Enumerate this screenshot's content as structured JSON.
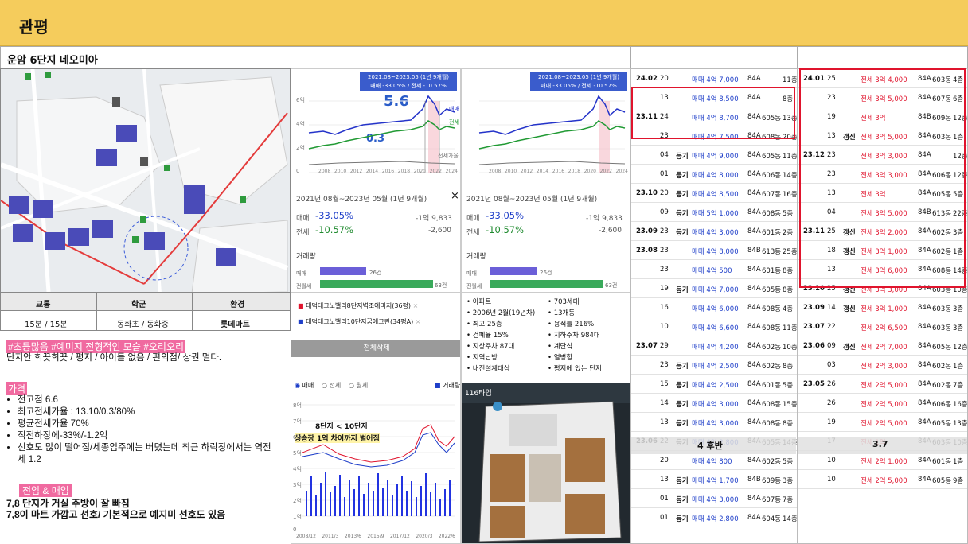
{
  "header": {
    "title": "관평"
  },
  "sheet": {
    "complex_name": "운암 6단지 네오미아"
  },
  "info_table": {
    "headers": [
      "교통",
      "학군",
      "환경"
    ],
    "values": [
      "15분 / 15분",
      "동화초 / 동화중",
      "롯데마트"
    ]
  },
  "notes": {
    "hashtags": "#초등많음 #예미지 전형적인 모습 #오리오리",
    "desc": "단지안 희끗희끗 / 평지 / 아이들 없음 / 편의점/ 상권 멀다.",
    "price_tag": "가격",
    "bullets": [
      "전고점 6.6",
      "최고전세가율 : 13.10/0.3/80%",
      "평균전세가율 70%",
      "직전하장에-33%/-1.2억",
      "선호도 많이 떨어짐/세종입주에는 버텼는데 최근 하락장에서는 역전세 1.2"
    ],
    "tag2": "전임 & 매임",
    "line1": "7,8 단지가 거실 주방이 잘 빠짐",
    "line2": "7,8이 마트 가깝고 선호/ 기본적으로 예지미 선호도 있음"
  },
  "chart_card_1": {
    "period": "2021.08~2023.05 (1년 9개월)",
    "summary": "매매 -33.05% / 전세 -10.57%",
    "peak_annot": "5.6",
    "low_annot": "0.3",
    "x_ticks": [
      "2008",
      "2010",
      "2012",
      "2014",
      "2016",
      "2018",
      "2020",
      "2022",
      "2024"
    ],
    "legend": [
      "매매",
      "전세"
    ],
    "y_ticks": [
      "6억",
      "4억",
      "2억",
      "0"
    ],
    "side": "전세가율"
  },
  "chart_card_2": {
    "period": "2021.08~2023.05 (1년 9개월)",
    "summary": "매매 -33.05% / 전세 -10.57%",
    "x_ticks": [
      "2008",
      "2010",
      "2012",
      "2014",
      "2016",
      "2018",
      "2020",
      "2022",
      "2024"
    ]
  },
  "stats": {
    "period": "2021년 08월~2023년 05월 (1년 9개월)",
    "rows": [
      {
        "label": "매매",
        "pct": "-33.05%",
        "amt": "-1억 9,833"
      },
      {
        "label": "전세",
        "pct": "-10.57%",
        "amt": "-2,600"
      }
    ],
    "volume_title": "거래량",
    "volume": [
      {
        "label": "매매",
        "value": "26건"
      },
      {
        "label": "전월세",
        "value": "63건"
      }
    ],
    "close": "×"
  },
  "stats2": {
    "period": "2021년 08월~2023년 05월 (1년 9개월)",
    "rows": [
      {
        "label": "매매",
        "pct": "-33.05%",
        "amt": "-1억 9,833"
      },
      {
        "label": "전세",
        "pct": "-10.57%",
        "amt": "-2,600"
      }
    ],
    "volume_title": "거래량",
    "volume": [
      {
        "label": "매매",
        "value": "26건"
      },
      {
        "label": "전월세",
        "value": "63건"
      }
    ]
  },
  "compare": {
    "items": [
      "대덕테크노밸리8단지벽조예미지(36평)",
      "대덕테크노밸리10단지꿈에그린(34평A)"
    ],
    "delete_btn": "전체삭제",
    "radios": [
      "매매",
      "전세",
      "월세"
    ],
    "vol_label": "거래량",
    "annot1": "8단지 < 10단지",
    "annot2": "상승장 1억 차이까지 벌어짐",
    "x_ticks": [
      "2008/12",
      "2011/3",
      "2013/6",
      "2015/9",
      "2017/12",
      "2020/3",
      "2022/6"
    ],
    "y_ticks": [
      "8억",
      "7억",
      "6억",
      "5억",
      "4억",
      "3억",
      "2억",
      "1억",
      "0"
    ]
  },
  "apt_info": {
    "col1": [
      "아파트",
      "2006년 2월(19년차)",
      "최고 25층",
      "건폐율 15%",
      "지상주차 87대",
      "지역난방",
      "내진설계대상"
    ],
    "col2": [
      "703세대",
      "13개동",
      "용적률 216%",
      "지하주차 984대",
      "계단식",
      "열병합",
      "평지에 있는 단지"
    ],
    "plan_label": "116타입"
  },
  "sale_list": {
    "rows": [
      [
        "24.02",
        "20",
        "",
        "매매 4억 7,000",
        "84A",
        "",
        "11층"
      ],
      [
        "",
        "13",
        "",
        "매매 4억 8,500",
        "84A",
        "",
        "8층"
      ],
      [
        "23.11",
        "24",
        "",
        "매매 4억 8,700",
        "84A",
        "605동",
        "13층"
      ],
      [
        "",
        "23",
        "",
        "매매 4억 7,500",
        "84A",
        "608동",
        "20층"
      ],
      [
        "",
        "04",
        "등기",
        "매매 4억 9,000",
        "84A",
        "605동",
        "11층"
      ],
      [
        "",
        "01",
        "등기",
        "매매 4억 8,000",
        "84A",
        "606동",
        "14층"
      ],
      [
        "23.10",
        "20",
        "등기",
        "매매 4억 8,500",
        "84A",
        "607동",
        "16층"
      ],
      [
        "",
        "09",
        "등기",
        "매매 5억 1,000",
        "84A",
        "608동",
        "5층"
      ],
      [
        "23.09",
        "23",
        "등기",
        "매매 4억 3,000",
        "84A",
        "601동",
        "2층"
      ],
      [
        "23.08",
        "23",
        "",
        "매매 4억 8,000",
        "84B",
        "613동",
        "25층"
      ],
      [
        "",
        "23",
        "",
        "매매 4억 500",
        "84A",
        "601동",
        "8층"
      ],
      [
        "",
        "19",
        "등기",
        "매매 4억 7,000",
        "84A",
        "605동",
        "8층"
      ],
      [
        "",
        "16",
        "",
        "매매 4억 6,000",
        "84A",
        "608동",
        "4층"
      ],
      [
        "",
        "10",
        "",
        "매매 4억 6,600",
        "84A",
        "608동",
        "11층"
      ],
      [
        "23.07",
        "29",
        "",
        "매매 4억 4,200",
        "84A",
        "602동",
        "10층"
      ],
      [
        "",
        "23",
        "등기",
        "매매 4억 2,500",
        "84A",
        "602동",
        "8층"
      ],
      [
        "",
        "15",
        "등기",
        "매매 4억 2,500",
        "84A",
        "601동",
        "5층"
      ],
      [
        "",
        "14",
        "등기",
        "매매 4억 3,000",
        "84A",
        "608동",
        "15층"
      ],
      [
        "",
        "13",
        "등기",
        "매매 4억 3,000",
        "84A",
        "608동",
        "8층"
      ],
      [
        "23.06",
        "22",
        "등기",
        "매매 4억 2,800",
        "84A",
        "605동",
        "14층"
      ],
      [
        "",
        "20",
        "",
        "매매 4억 800",
        "84A",
        "602동",
        "5층"
      ],
      [
        "",
        "13",
        "등기",
        "매매 4억 1,700",
        "84B",
        "609동",
        "3층"
      ],
      [
        "",
        "01",
        "등기",
        "매매 4억 3,000",
        "84A",
        "607동",
        "7층"
      ],
      [
        "",
        "01",
        "등기",
        "매매 4억 2,800",
        "84A",
        "604동",
        "14층"
      ]
    ],
    "overlay": "4 후반"
  },
  "jeonse_list": {
    "rows": [
      [
        "24.01",
        "25",
        "",
        "전세 3억 4,000",
        "84A",
        "603동",
        "4층"
      ],
      [
        "",
        "23",
        "",
        "전세 3억 5,000",
        "84A",
        "607동",
        "6층"
      ],
      [
        "",
        "19",
        "",
        "전세 3억",
        "84B",
        "609동",
        "12층"
      ],
      [
        "",
        "13",
        "갱신",
        "전세 3억 5,000",
        "84A",
        "603동",
        "1층"
      ],
      [
        "23.12",
        "23",
        "",
        "전세 3억 3,000",
        "84A",
        "",
        "12층"
      ],
      [
        "",
        "23",
        "",
        "전세 3억 3,000",
        "84A",
        "606동",
        "12층"
      ],
      [
        "",
        "13",
        "",
        "전세 3억",
        "84A",
        "605동",
        "5층"
      ],
      [
        "",
        "04",
        "",
        "전세 3억 5,000",
        "84B",
        "613동",
        "22층"
      ],
      [
        "23.11",
        "25",
        "갱신",
        "전세 3억 2,000",
        "84A",
        "602동",
        "3층"
      ],
      [
        "",
        "18",
        "갱신",
        "전세 3억 1,000",
        "84A",
        "602동",
        "1층"
      ],
      [
        "",
        "13",
        "",
        "전세 3억 6,000",
        "84A",
        "608동",
        "14층"
      ],
      [
        "23.10",
        "25",
        "갱신",
        "전세 3억 3,000",
        "84A",
        "603동",
        "10층"
      ],
      [
        "23.09",
        "14",
        "갱신",
        "전세 3억 1,000",
        "84A",
        "603동",
        "3층"
      ],
      [
        "23.07",
        "22",
        "",
        "전세 2억 6,500",
        "84A",
        "603동",
        "3층"
      ],
      [
        "23.06",
        "09",
        "갱신",
        "전세 2억 7,000",
        "84A",
        "605동",
        "12층"
      ],
      [
        "",
        "03",
        "",
        "전세 2억 3,000",
        "84A",
        "602동",
        "1층"
      ],
      [
        "23.05",
        "26",
        "",
        "전세 2억 5,000",
        "84A",
        "602동",
        "7층"
      ],
      [
        "",
        "26",
        "",
        "전세 2억 5,000",
        "84A",
        "606동",
        "16층"
      ],
      [
        "",
        "19",
        "",
        "전세 2억 5,000",
        "84A",
        "605동",
        "13층"
      ],
      [
        "",
        "17",
        "",
        "전세 1억",
        "84A",
        "603동",
        "10층"
      ],
      [
        "",
        "10",
        "",
        "전세 2억 1,000",
        "84A",
        "601동",
        "1층"
      ],
      [
        "",
        "10",
        "",
        "전세 2억 5,000",
        "84A",
        "605동",
        "9층"
      ]
    ],
    "overlay": "3.7"
  },
  "colors": {
    "header_bg": "#f5cc5c",
    "red": "#e0142d",
    "blue": "#1f3fc9",
    "green": "#1e8a2e",
    "pink": "#f06aa0"
  }
}
